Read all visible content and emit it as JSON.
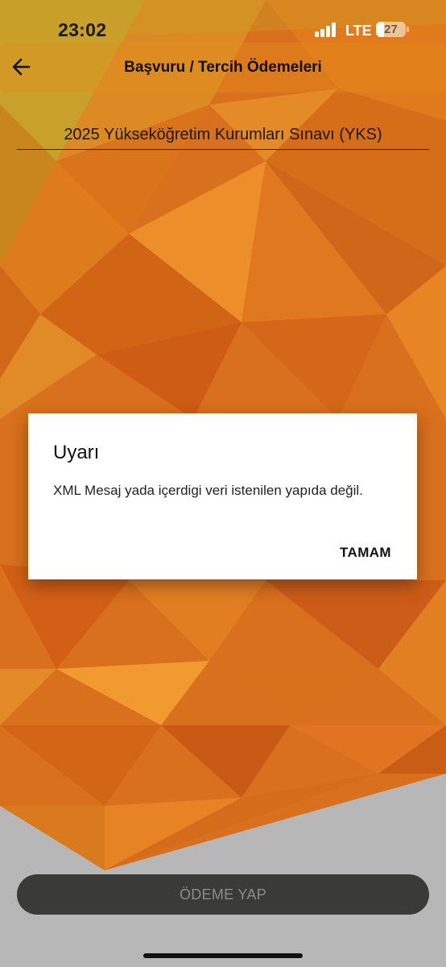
{
  "status_bar": {
    "time": "23:02",
    "network": "LTE",
    "battery": "27",
    "battery_level": 0.27
  },
  "header": {
    "back_icon": "arrow-left-icon",
    "title": "Başvuru / Tercih Ödemeleri"
  },
  "exam_select": {
    "value": "2025 Yükseköğretim Kurumları Sınavı (YKS)"
  },
  "dialog": {
    "title": "Uyarı",
    "message": "XML Mesaj yada içerdigi veri istenilen yapıda değil.",
    "ok_label": "TAMAM"
  },
  "actions": {
    "pay_label": "ÖDEME YAP"
  },
  "colors": {
    "background_orange": "#d9711c",
    "bottom_gray": "#b7b7b7",
    "button_dark": "#3a3a38",
    "dialog_bg": "#ffffff"
  }
}
